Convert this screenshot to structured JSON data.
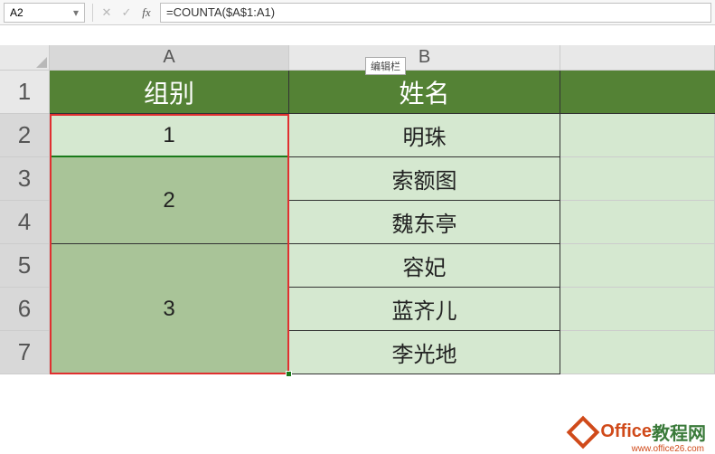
{
  "formula_bar": {
    "cell_ref": "A2",
    "formula": "=COUNTA($A$1:A1)",
    "tooltip": "编辑栏",
    "cancel_glyph": "✕",
    "enter_glyph": "✓",
    "fx_glyph": "fx",
    "dropdown_glyph": "▾"
  },
  "columns": {
    "A": "A",
    "B": "B",
    "C": ""
  },
  "rows": {
    "1": "1",
    "2": "2",
    "3": "3",
    "4": "4",
    "5": "5",
    "6": "6",
    "7": "7"
  },
  "headers": {
    "colA": "组别",
    "colB": "姓名"
  },
  "data": {
    "groups": [
      {
        "label": "1",
        "span": 1
      },
      {
        "label": "2",
        "span": 2
      },
      {
        "label": "3",
        "span": 3
      }
    ],
    "names": [
      "明珠",
      "索额图",
      "魏东亭",
      "容妃",
      "蓝齐儿",
      "李光地"
    ]
  },
  "watermark": {
    "brand1": "Office",
    "brand2": "教程网",
    "url": "www.office26.com"
  },
  "colors": {
    "header_bg": "#548235",
    "light_cell": "#d5e8d0",
    "selected_cell": "#a9c498",
    "red_box": "#e03030"
  }
}
